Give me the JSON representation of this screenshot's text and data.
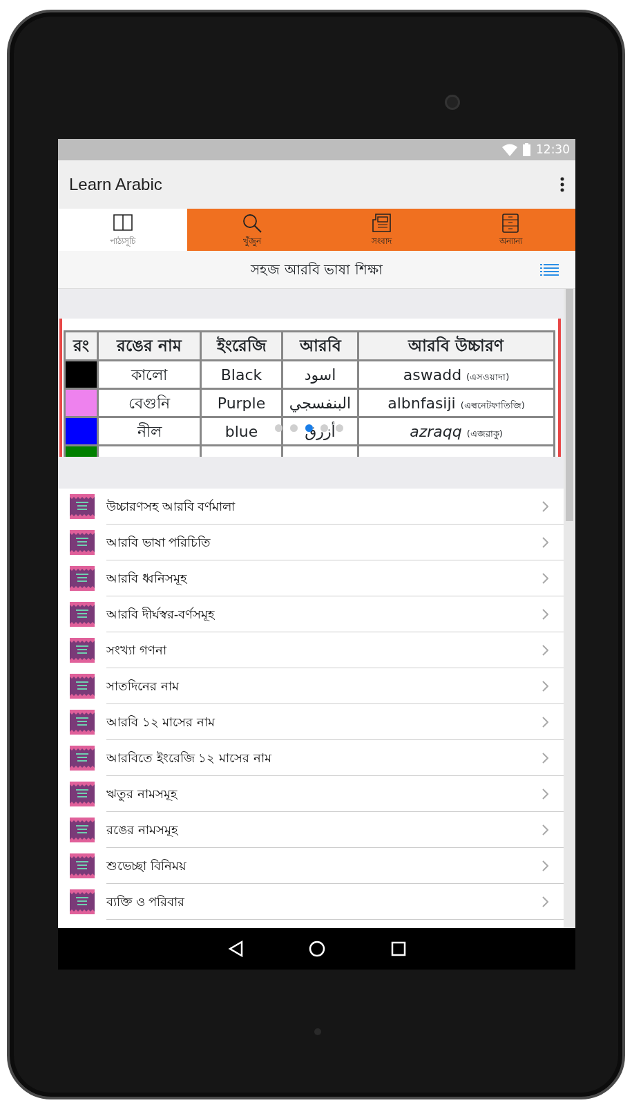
{
  "status_bar": {
    "time": "12:30"
  },
  "app_bar": {
    "title": "Learn Arabic"
  },
  "tabs": [
    {
      "label": "পাঠ্যসূচি",
      "selected": true
    },
    {
      "label": "খুঁজুন",
      "selected": false
    },
    {
      "label": "সংবাদ",
      "selected": false
    },
    {
      "label": "অন্যান্য",
      "selected": false
    }
  ],
  "header": {
    "title": "সহজ আরবি ভাষা শিক্ষা"
  },
  "banner": {
    "table": {
      "columns": [
        "রং",
        "রঙের নাম",
        "ইংরেজি",
        "আরবি",
        "আরবি উচ্চারণ"
      ],
      "rows": [
        {
          "color": "#000000",
          "name": "কালো",
          "english": "Black",
          "arabic": "اسود",
          "pronunciation": "aswadd",
          "pronunciation_bn": "(এসওয়াদা)"
        },
        {
          "color": "#ee82ee",
          "name": "বেগুনি",
          "english": "Purple",
          "arabic": "البنفسجي",
          "pronunciation": "albnfasiji",
          "pronunciation_bn": "(এল্বনেটফাতিজি)"
        },
        {
          "color": "#0000ff",
          "name": "নীল",
          "english": "blue",
          "arabic": "أزرق",
          "pronunciation": "*azraqq*",
          "pronunciation_bn": "(এজরাকু)"
        },
        {
          "color": "#008000"
        }
      ]
    },
    "dots": [
      {
        "selected": false
      },
      {
        "selected": false
      },
      {
        "selected": true
      },
      {
        "selected": false
      },
      {
        "selected": false
      }
    ]
  },
  "items": [
    {
      "title": "উচ্চারণসহ আরবি বর্ণমালা"
    },
    {
      "title": "আরবি ভাষা পরিচিতি"
    },
    {
      "title": "আরবি ধ্বনিসমূহ"
    },
    {
      "title": "আরবি দীর্ঘস্বর-বর্ণসমূহ"
    },
    {
      "title": "সংখ্যা গণনা"
    },
    {
      "title": "সাতদিনের নাম"
    },
    {
      "title": "আরবি ১২ মাসের নাম"
    },
    {
      "title": "আরবিতে ইংরেজি ১২ মাসের নাম"
    },
    {
      "title": "ঋতুর নামসমূহ"
    },
    {
      "title": "রঙের নামসমূহ"
    },
    {
      "title": "শুভেচ্ছা বিনিময়"
    },
    {
      "title": "ব্যক্তি ও পরিবার"
    }
  ]
}
